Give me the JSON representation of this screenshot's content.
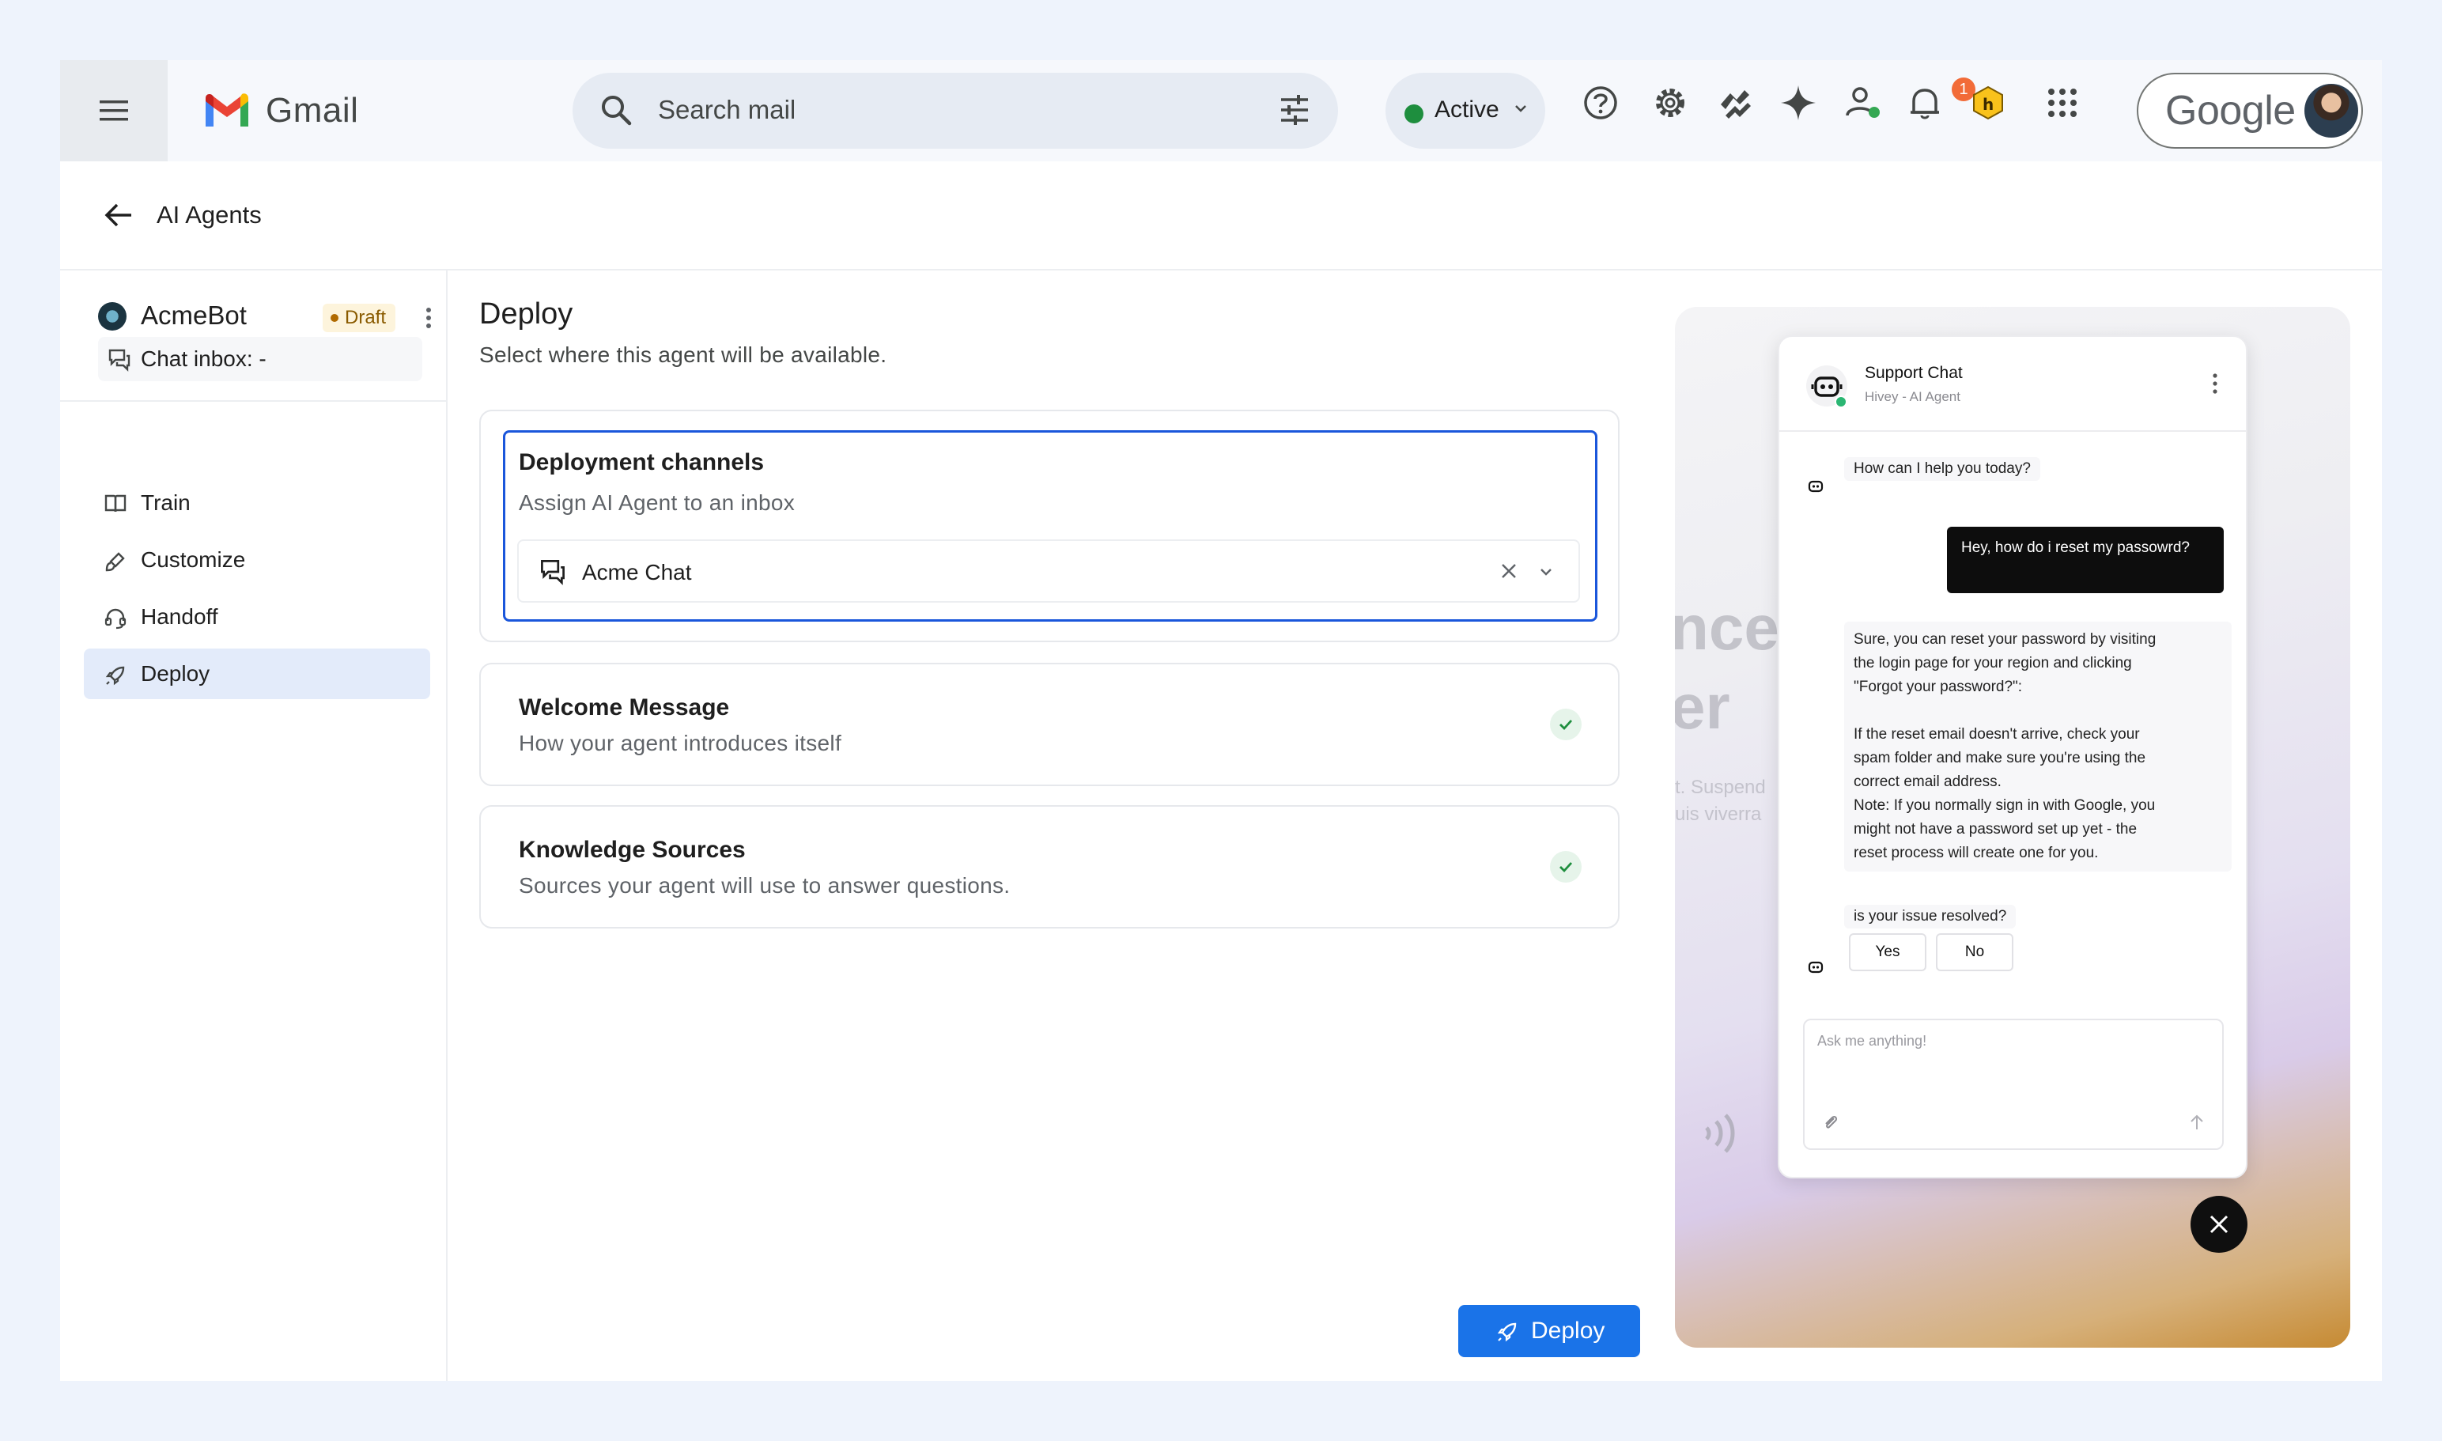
{
  "topbar": {
    "app_name": "Gmail",
    "search_placeholder": "Search mail",
    "status": {
      "label": "Active",
      "color": "#1e8e3e"
    },
    "notification_count": "1",
    "account_label": "Google"
  },
  "page": {
    "title": "AI Agents"
  },
  "agent": {
    "name": "AcmeBot",
    "status_badge": "Draft",
    "inbox_label": "Chat inbox: -"
  },
  "nav": {
    "items": [
      {
        "label": "Train",
        "icon": "book-icon"
      },
      {
        "label": "Customize",
        "icon": "brush-icon"
      },
      {
        "label": "Handoff",
        "icon": "headset-icon"
      },
      {
        "label": "Deploy",
        "icon": "rocket-icon",
        "active": true
      }
    ]
  },
  "main": {
    "title": "Deploy",
    "subtitle": "Select where this agent will be available.",
    "deployment": {
      "title": "Deployment channels",
      "subtitle": "Assign AI Agent to an inbox",
      "selected_inbox": "Acme Chat"
    },
    "welcome": {
      "title": "Welcome Message",
      "subtitle": "How your agent introduces itself"
    },
    "knowledge": {
      "title": "Knowledge Sources",
      "subtitle": "Sources your agent will use to answer questions."
    },
    "deploy_button": "Deploy"
  },
  "preview": {
    "background_text": [
      "nce",
      "er"
    ],
    "background_small_text": [
      "t. Suspend",
      "uis viverra"
    ],
    "chat": {
      "title": "Support Chat",
      "subtitle": "Hivey - AI Agent",
      "greeting": "How can I help you today?",
      "user_message": "Hey, how do i reset my passowrd?",
      "reply_lines": [
        "Sure, you can reset your password by visiting",
        "the login page for your region and clicking",
        "\"Forgot your password?\":",
        "",
        "If the reset email doesn't arrive, check your",
        "spam folder and make sure you're using the",
        "correct email address.",
        "Note: If you normally sign in with Google, you",
        "might not have a password set up yet - the",
        "reset process will create one for you."
      ],
      "question": "is your issue resolved?",
      "yes_label": "Yes",
      "no_label": "No",
      "input_placeholder": "Ask me anything!"
    }
  },
  "colors": {
    "accent": "#1a73e8",
    "focus_border": "#1a56db",
    "nav_active_bg": "#e3ebfa",
    "draft_badge_bg": "#fdf4dc",
    "check_green": "#1e8e3e"
  }
}
